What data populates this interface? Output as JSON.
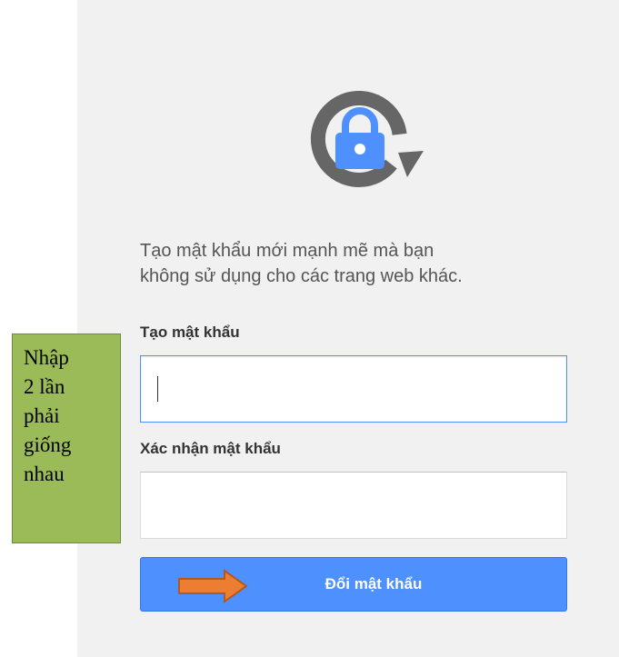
{
  "description": {
    "line1": "Tạo mật khẩu mới mạnh mẽ mà bạn",
    "line2": "không sử dụng cho các trang web khác."
  },
  "form": {
    "new_password_label": "Tạo mật khẩu",
    "new_password_value": "",
    "confirm_password_label": "Xác nhận mật khẩu",
    "confirm_password_value": "",
    "submit_label": "Đổi mật khẩu"
  },
  "annotation": {
    "lines": [
      "Nhập",
      "2 lần",
      "phải",
      "giống",
      "nhau"
    ]
  },
  "colors": {
    "accent": "#4d90fe",
    "lock_ring": "#666666",
    "note_bg": "#9bbb59",
    "arrow": "#ed7d31"
  },
  "icons": {
    "header": "lock-refresh-icon",
    "pointer": "right-arrow-icon"
  }
}
